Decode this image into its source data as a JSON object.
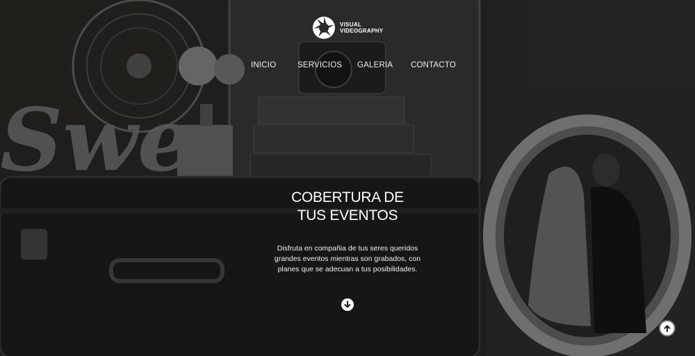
{
  "brand": {
    "line1": "VISUAL",
    "line2": "VIDEOGRAPHY",
    "logo_icon": "camera-aperture-icon"
  },
  "nav": {
    "items": [
      {
        "label": "INICIO"
      },
      {
        "label": "SERVICIOS"
      },
      {
        "label": "GALERIA"
      },
      {
        "label": "CONTACTO"
      }
    ]
  },
  "hero": {
    "headline_line1": "COBERTURA DE",
    "headline_line2": "TUS EVENTOS",
    "description": "Disfruta en compañia de tus seres queridos grandes eventos mientras son grabados, con planes que se adecuan a tus posibilidades.",
    "scroll_down_icon": "arrow-down-circle-icon",
    "back_to_top_icon": "arrow-up-circle-icon",
    "background_image": "vintage suitcases, fan, camera, books and oval wedding portrait in black and white"
  },
  "colors": {
    "text": "#ffffff",
    "overlay": "#000000"
  }
}
